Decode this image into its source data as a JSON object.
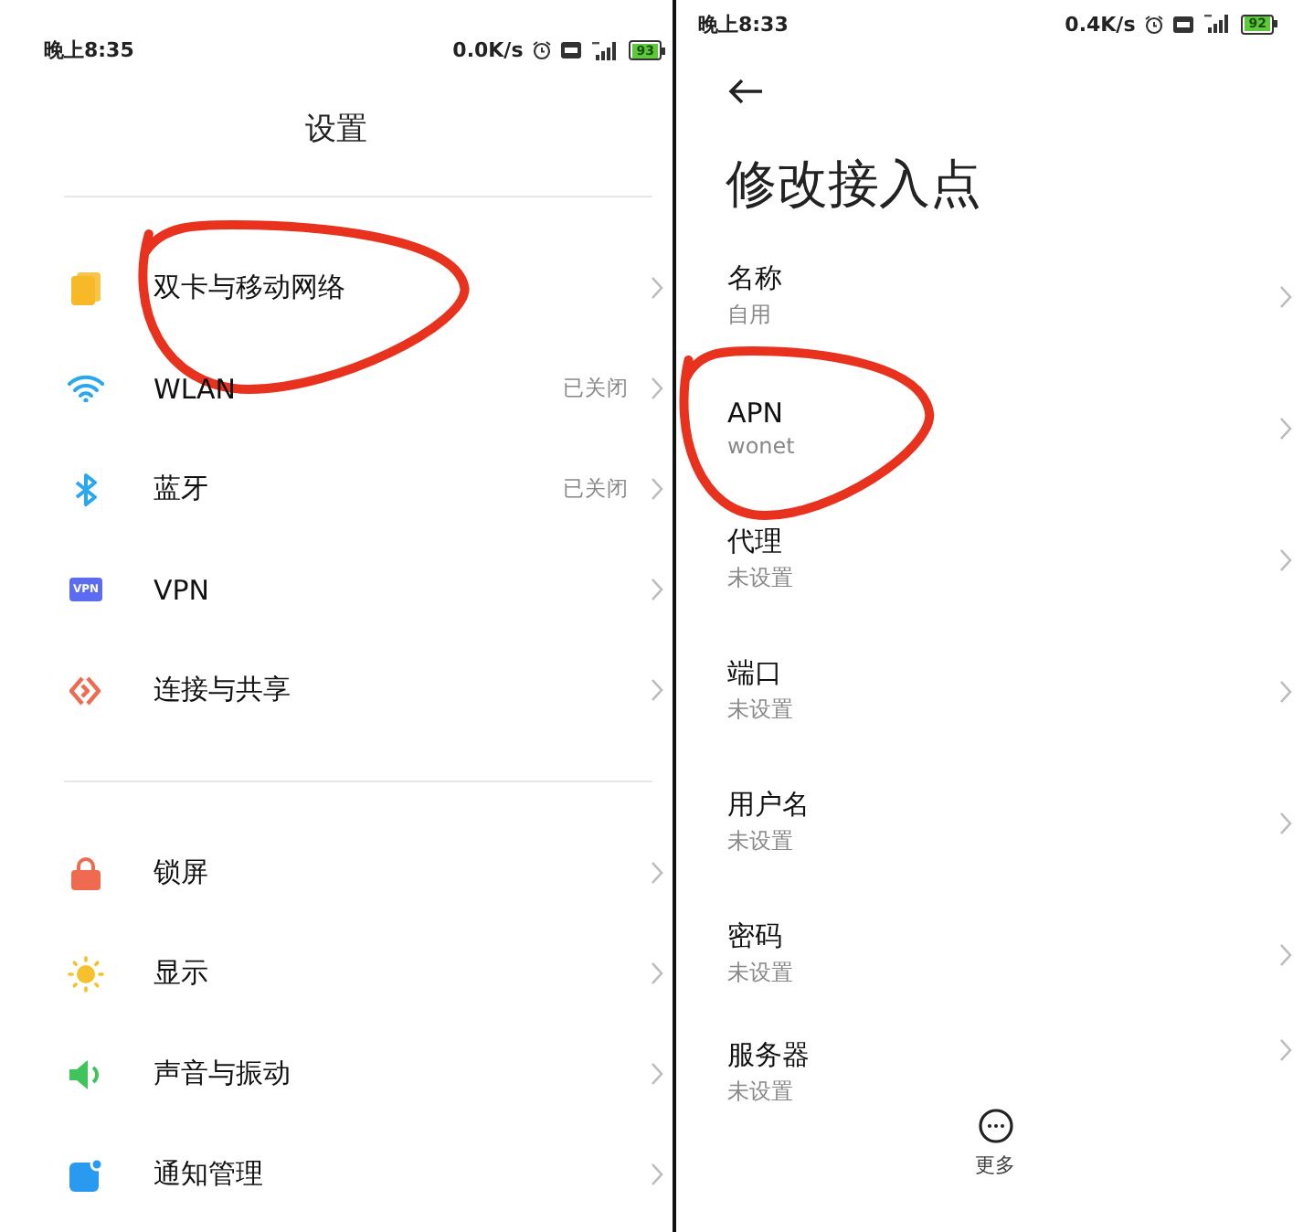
{
  "left_screen": {
    "status_bar": {
      "time": "晚上8:35",
      "speed": "0.0K/s",
      "battery": "93"
    },
    "title": "设置",
    "groups": [
      [
        {
          "kind": "sim",
          "label": "双卡与移动网络",
          "circled": true
        },
        {
          "kind": "wifi",
          "label": "WLAN",
          "value": "已关闭",
          "circled": false
        },
        {
          "kind": "bluetooth",
          "label": "蓝牙",
          "value": "已关闭",
          "circled": false
        },
        {
          "kind": "vpn",
          "icon_text": "VPN",
          "label": "VPN",
          "circled": false
        },
        {
          "kind": "share",
          "label": "连接与共享",
          "circled": false
        }
      ],
      [
        {
          "kind": "lock",
          "label": "锁屏",
          "circled": false
        },
        {
          "kind": "sun",
          "label": "显示",
          "circled": false
        },
        {
          "kind": "sound",
          "label": "声音与振动",
          "circled": false
        },
        {
          "kind": "notification",
          "label": "通知管理",
          "circled": false
        }
      ]
    ]
  },
  "right_screen": {
    "status_bar": {
      "time": "晚上8:33",
      "speed": "0.4K/s",
      "battery": "92"
    },
    "title": "修改接入点",
    "fields": [
      {
        "label": "名称",
        "value": "自用",
        "circled": false
      },
      {
        "label": "APN",
        "value": "wonet",
        "circled": true
      },
      {
        "label": "代理",
        "value": "未设置",
        "circled": false
      },
      {
        "label": "端口",
        "value": "未设置",
        "circled": false
      },
      {
        "label": "用户名",
        "value": "未设置",
        "circled": false
      },
      {
        "label": "密码",
        "value": "未设置",
        "circled": false
      },
      {
        "label": "服务器",
        "value": "未设置",
        "circled": false
      }
    ],
    "more_button": "更多"
  }
}
